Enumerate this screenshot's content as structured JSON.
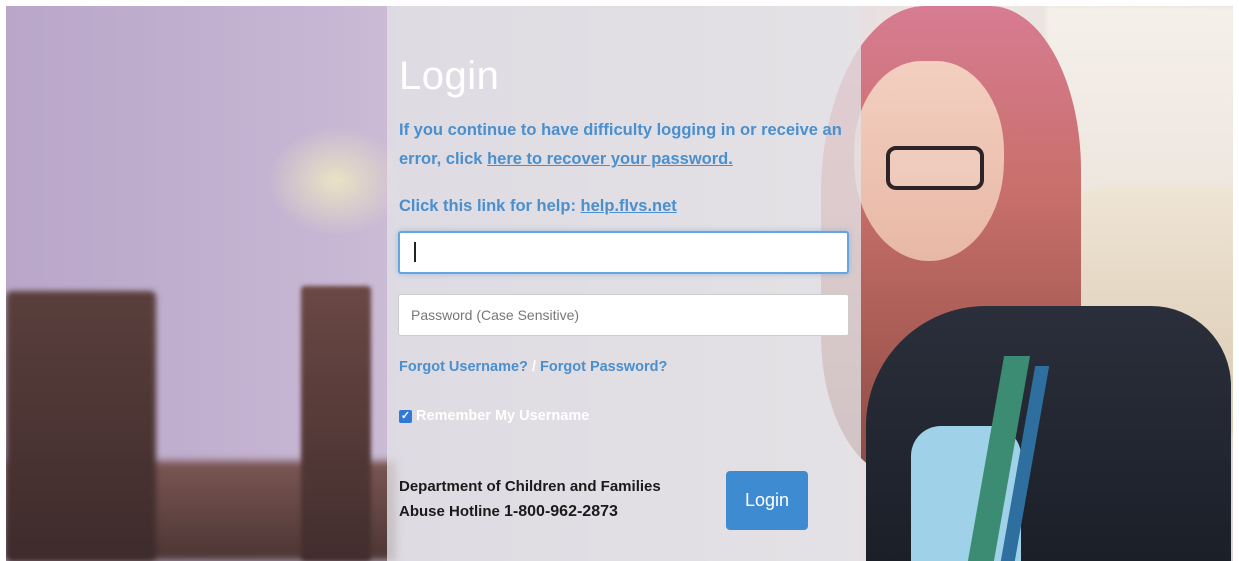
{
  "login": {
    "title": "Login",
    "info_text": "If you continue to have difficulty logging in or receive an error, click ",
    "recover_link": "here to recover your password.",
    "help_text": "Click this link for help: ",
    "help_link": "help.flvs.net",
    "username_value": "",
    "password_placeholder": "Password (Case Sensitive)",
    "forgot_username": "Forgot Username?",
    "separator": " / ",
    "forgot_password": "Forgot Password?",
    "remember_label": "Remember My Username",
    "remember_checked": true,
    "dcf_line1": "Department of Children and Families",
    "dcf_line2": "Abuse Hotline ",
    "hotline_number": "1-800-962-2873",
    "login_button": "Login"
  },
  "icons": {
    "checkbox": "check-icon"
  },
  "colors": {
    "link_blue": "#4a8fce",
    "button_blue": "#3e8bd1",
    "focus_border": "#66a6e0"
  }
}
